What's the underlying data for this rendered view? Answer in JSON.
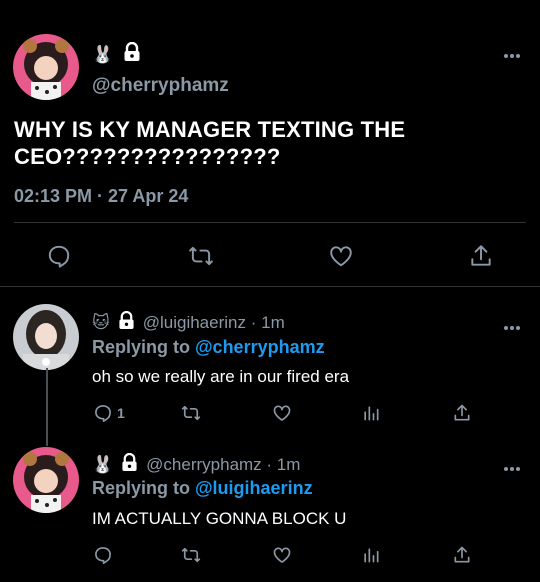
{
  "main_tweet": {
    "handle": "@cherryphamz",
    "badge_emoji": "🐰",
    "text": "WHY IS KY MANAGER TEXTING THE CEO????????????????",
    "time": "02:13 PM",
    "sep": " · ",
    "date": "27 Apr 24"
  },
  "replies": [
    {
      "badge_emoji": "🐱",
      "handle": "@luigihaerinz",
      "sep": " · ",
      "age": "1m",
      "replying_prefix": "Replying to ",
      "replying_to": "@cherryphamz",
      "text": "oh so we really are in our fired era",
      "reply_count": "1"
    },
    {
      "badge_emoji": "🐰",
      "handle": "@cherryphamz",
      "sep": " · ",
      "age": "1m",
      "replying_prefix": "Replying to ",
      "replying_to": "@luigihaerinz",
      "text": "IM ACTUALLY GONNA BLOCK U",
      "reply_count": ""
    }
  ],
  "colors": {
    "background": "#000000",
    "text": "#e7e9ea",
    "muted": "#8b98a5",
    "link": "#1d9bf0",
    "divider": "#2f3336"
  },
  "icons": [
    "comment-icon",
    "retweet-icon",
    "like-icon",
    "share-icon",
    "analytics-icon",
    "lock-icon",
    "more-icon"
  ]
}
